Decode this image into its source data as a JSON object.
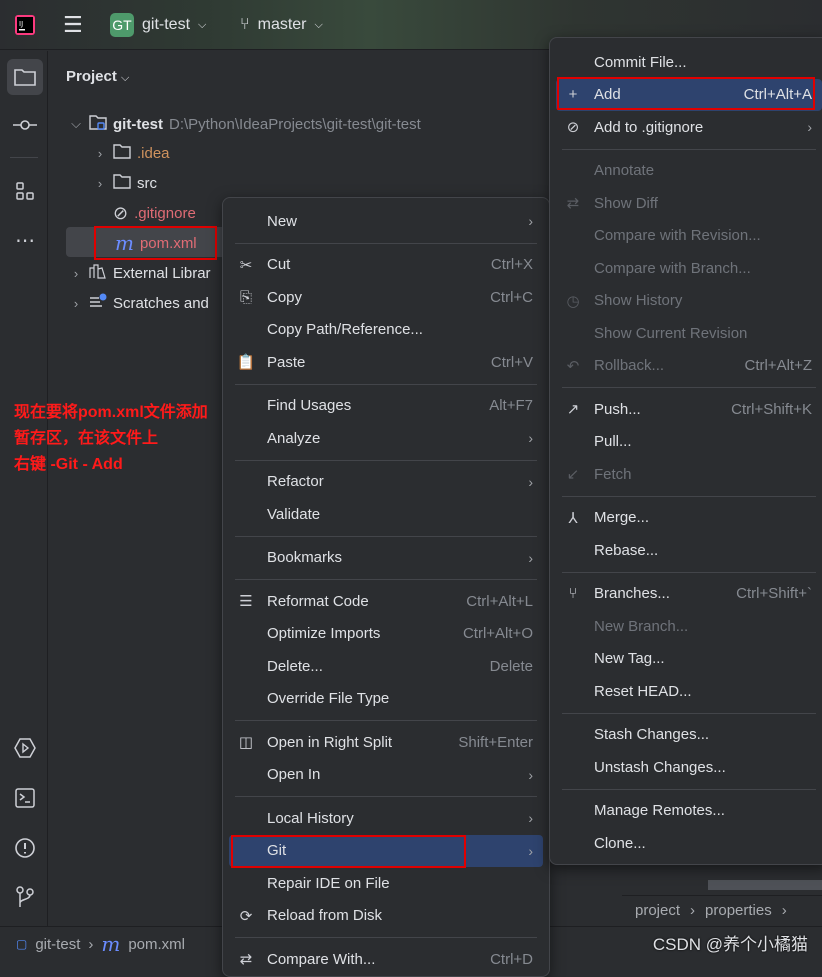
{
  "titlebar": {
    "project_badge": "GT",
    "project_name": "git-test",
    "branch": "master"
  },
  "project_panel": {
    "title": "Project",
    "tree": [
      {
        "label": "git-test",
        "path": "D:\\Python\\IdeaProjects\\git-test\\git-test",
        "icon": "module-folder-icon",
        "expanded": true
      },
      {
        "label": ".idea",
        "icon": "folder-icon",
        "color": "#d0935e"
      },
      {
        "label": "src",
        "icon": "folder-icon"
      },
      {
        "label": ".gitignore",
        "icon": "ignored-file-icon",
        "color": "#e06c75"
      },
      {
        "label": "pom.xml",
        "icon": "maven-icon",
        "color": "#e06c75",
        "selected": true
      },
      {
        "label": "External Librar",
        "icon": "library-icon"
      },
      {
        "label": "Scratches and",
        "icon": "scratches-icon"
      }
    ]
  },
  "annotation": {
    "lines": [
      "现在要将pom.xml文件添加",
      "暂存区，在该文件上",
      "右键 -Git - Add"
    ],
    "color": "#ff1a1a"
  },
  "context_menu": [
    {
      "label": "New",
      "submenu": true
    },
    {
      "sep": true
    },
    {
      "label": "Cut",
      "shortcut": "Ctrl+X",
      "icon": "✂",
      "icon_name": "scissors-icon"
    },
    {
      "label": "Copy",
      "shortcut": "Ctrl+C",
      "icon": "⎘",
      "icon_name": "copy-icon"
    },
    {
      "label": "Copy Path/Reference..."
    },
    {
      "label": "Paste",
      "shortcut": "Ctrl+V",
      "icon": "📋",
      "icon_name": "paste-icon"
    },
    {
      "sep": true
    },
    {
      "label": "Find Usages",
      "shortcut": "Alt+F7"
    },
    {
      "label": "Analyze",
      "submenu": true
    },
    {
      "sep": true
    },
    {
      "label": "Refactor",
      "submenu": true
    },
    {
      "label": "Validate"
    },
    {
      "sep": true
    },
    {
      "label": "Bookmarks",
      "submenu": true
    },
    {
      "sep": true
    },
    {
      "label": "Reformat Code",
      "shortcut": "Ctrl+Alt+L",
      "icon": "☰",
      "icon_name": "reformat-icon"
    },
    {
      "label": "Optimize Imports",
      "shortcut": "Ctrl+Alt+O"
    },
    {
      "label": "Delete...",
      "shortcut": "Delete"
    },
    {
      "label": "Override File Type"
    },
    {
      "sep": true
    },
    {
      "label": "Open in Right Split",
      "shortcut": "Shift+Enter",
      "icon": "◫",
      "icon_name": "split-icon"
    },
    {
      "label": "Open In",
      "submenu": true
    },
    {
      "sep": true
    },
    {
      "label": "Local History",
      "submenu": true
    },
    {
      "label": "Git",
      "submenu": true,
      "highlighted": true
    },
    {
      "label": "Repair IDE on File"
    },
    {
      "label": "Reload from Disk",
      "icon": "⟳",
      "icon_name": "reload-icon"
    },
    {
      "sep": true
    },
    {
      "label": "Compare With...",
      "shortcut": "Ctrl+D",
      "icon": "⇄",
      "icon_name": "compare-icon"
    }
  ],
  "git_submenu": [
    {
      "label": "Commit File..."
    },
    {
      "label": "Add",
      "shortcut": "Ctrl+Alt+A",
      "icon": "+",
      "icon_name": "plus-icon",
      "highlighted": true
    },
    {
      "label": "Add to .gitignore",
      "submenu": true,
      "icon": "⊘",
      "icon_name": "ignore-icon"
    },
    {
      "sep": true
    },
    {
      "label": "Annotate",
      "disabled": true
    },
    {
      "label": "Show Diff",
      "disabled": true,
      "icon": "⇄",
      "icon_name": "diff-icon"
    },
    {
      "label": "Compare with Revision...",
      "disabled": true
    },
    {
      "label": "Compare with Branch...",
      "disabled": true
    },
    {
      "label": "Show History",
      "disabled": true,
      "icon": "◷",
      "icon_name": "history-icon"
    },
    {
      "label": "Show Current Revision",
      "disabled": true
    },
    {
      "label": "Rollback...",
      "shortcut": "Ctrl+Alt+Z",
      "disabled": true,
      "icon": "↶",
      "icon_name": "rollback-icon"
    },
    {
      "sep": true
    },
    {
      "label": "Push...",
      "shortcut": "Ctrl+Shift+K",
      "icon": "↗",
      "icon_name": "push-icon"
    },
    {
      "label": "Pull..."
    },
    {
      "label": "Fetch",
      "disabled": true,
      "icon": "↙",
      "icon_name": "fetch-icon"
    },
    {
      "sep": true
    },
    {
      "label": "Merge...",
      "icon": "⅄",
      "icon_name": "merge-icon"
    },
    {
      "label": "Rebase..."
    },
    {
      "sep": true
    },
    {
      "label": "Branches...",
      "shortcut": "Ctrl+Shift+`",
      "icon": "⑂",
      "icon_name": "branch-icon"
    },
    {
      "label": "New Branch...",
      "disabled": true
    },
    {
      "label": "New Tag..."
    },
    {
      "label": "Reset HEAD..."
    },
    {
      "sep": true
    },
    {
      "label": "Stash Changes..."
    },
    {
      "label": "Unstash Changes..."
    },
    {
      "sep": true
    },
    {
      "label": "Manage Remotes..."
    },
    {
      "label": "Clone..."
    }
  ],
  "editor_breadcrumbs": [
    "project",
    "properties"
  ],
  "statusbar": {
    "project": "git-test",
    "file": "pom.xml"
  },
  "watermark": "CSDN @养个小橘猫",
  "colors": {
    "highlight": "#2e436e",
    "annotation_box": "#e00000"
  }
}
